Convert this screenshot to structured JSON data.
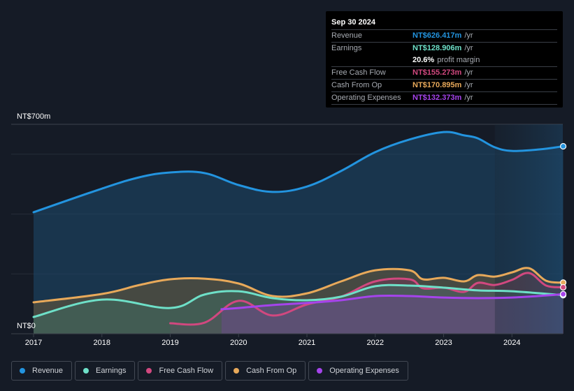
{
  "tooltip": {
    "date": "Sep 30 2024",
    "rows": [
      {
        "label": "Revenue",
        "value": "NT$626.417m",
        "unit": "/yr",
        "color": "#2394df"
      },
      {
        "label": "Earnings",
        "value": "NT$128.906m",
        "unit": "/yr",
        "color": "#6ee0c8"
      },
      {
        "label": "",
        "value": "20.6%",
        "unit": "profit margin",
        "color": "#ffffff"
      },
      {
        "label": "Free Cash Flow",
        "value": "NT$155.273m",
        "unit": "/yr",
        "color": "#d1487f"
      },
      {
        "label": "Cash From Op",
        "value": "NT$170.895m",
        "unit": "/yr",
        "color": "#e8a95a"
      },
      {
        "label": "Operating Expenses",
        "value": "NT$132.373m",
        "unit": "/yr",
        "color": "#a544ec"
      }
    ]
  },
  "legend": [
    {
      "label": "Revenue",
      "color": "#2394df"
    },
    {
      "label": "Earnings",
      "color": "#6ee0c8"
    },
    {
      "label": "Free Cash Flow",
      "color": "#d1487f"
    },
    {
      "label": "Cash From Op",
      "color": "#e8a95a"
    },
    {
      "label": "Operating Expenses",
      "color": "#a544ec"
    }
  ],
  "chart_data": {
    "type": "area",
    "title": "",
    "xlabel": "",
    "ylabel": "",
    "y_top_label": "NT$700m",
    "y_bottom_label": "NT$0",
    "ylim": [
      0,
      700
    ],
    "xlim": [
      2016.99,
      2024.75
    ],
    "x_ticks": [
      "2017",
      "2018",
      "2019",
      "2020",
      "2021",
      "2022",
      "2023",
      "2024"
    ],
    "x_tick_values": [
      2017,
      2018,
      2019,
      2020,
      2021,
      2022,
      2023,
      2024
    ],
    "y_gridlines": [
      0,
      200,
      400,
      600,
      700
    ],
    "grid": true,
    "highlight_from": 2023.75,
    "legend_position": "bottom",
    "series": [
      {
        "name": "Revenue",
        "color": "#2394df",
        "fill": "#1e4a6e",
        "x": [
          2017.0,
          2018.0,
          2018.55,
          2019.0,
          2019.5,
          2020.0,
          2020.5,
          2021.0,
          2021.5,
          2022.0,
          2022.5,
          2023.0,
          2023.3,
          2023.5,
          2023.75,
          2024.0,
          2024.4,
          2024.75
        ],
        "values": [
          406,
          485,
          523,
          539,
          537,
          497,
          474,
          492,
          544,
          607,
          649,
          674,
          663,
          653,
          623,
          611,
          616,
          626.417
        ]
      },
      {
        "name": "Cash From Op",
        "color": "#e8a95a",
        "fill": "#6b5a3a",
        "x": [
          2017.0,
          2018.0,
          2018.55,
          2019.0,
          2019.5,
          2020.0,
          2020.5,
          2021.0,
          2021.5,
          2022.0,
          2022.5,
          2022.7,
          2023.0,
          2023.3,
          2023.5,
          2023.75,
          2024.0,
          2024.25,
          2024.5,
          2024.75
        ],
        "values": [
          105,
          133,
          163,
          182,
          184,
          168,
          126,
          135,
          175,
          212,
          212,
          182,
          187,
          175,
          196,
          191,
          205,
          219,
          177,
          170.895
        ]
      },
      {
        "name": "Free Cash Flow",
        "color": "#d1487f",
        "fill": "#6e3a55",
        "x": [
          2019.0,
          2019.5,
          2020.0,
          2020.5,
          2021.0,
          2021.5,
          2022.0,
          2022.5,
          2022.7,
          2023.0,
          2023.3,
          2023.5,
          2023.75,
          2024.0,
          2024.25,
          2024.5,
          2024.75
        ],
        "values": [
          35,
          37,
          110,
          61,
          98,
          124,
          175,
          182,
          152,
          154,
          140,
          170,
          163,
          180,
          203,
          161,
          155.273
        ]
      },
      {
        "name": "Earnings",
        "color": "#6ee0c8",
        "fill": "#3f6b62",
        "x": [
          2017.0,
          2018.0,
          2019.0,
          2019.5,
          2020.0,
          2020.5,
          2021.0,
          2021.5,
          2022.0,
          2022.5,
          2023.0,
          2023.5,
          2024.0,
          2024.75
        ],
        "values": [
          56,
          114,
          86,
          131,
          142,
          119,
          112,
          124,
          159,
          161,
          154,
          145,
          142,
          128.906
        ]
      },
      {
        "name": "Operating Expenses",
        "color": "#a544ec",
        "fill": "#6a4a8a",
        "x": [
          2019.75,
          2020.0,
          2020.5,
          2021.0,
          2021.5,
          2022.0,
          2022.5,
          2023.0,
          2023.5,
          2024.0,
          2024.5,
          2024.75
        ],
        "values": [
          82,
          86,
          96,
          103,
          112,
          126,
          126,
          121,
          119,
          121,
          128,
          132.373
        ]
      }
    ]
  }
}
